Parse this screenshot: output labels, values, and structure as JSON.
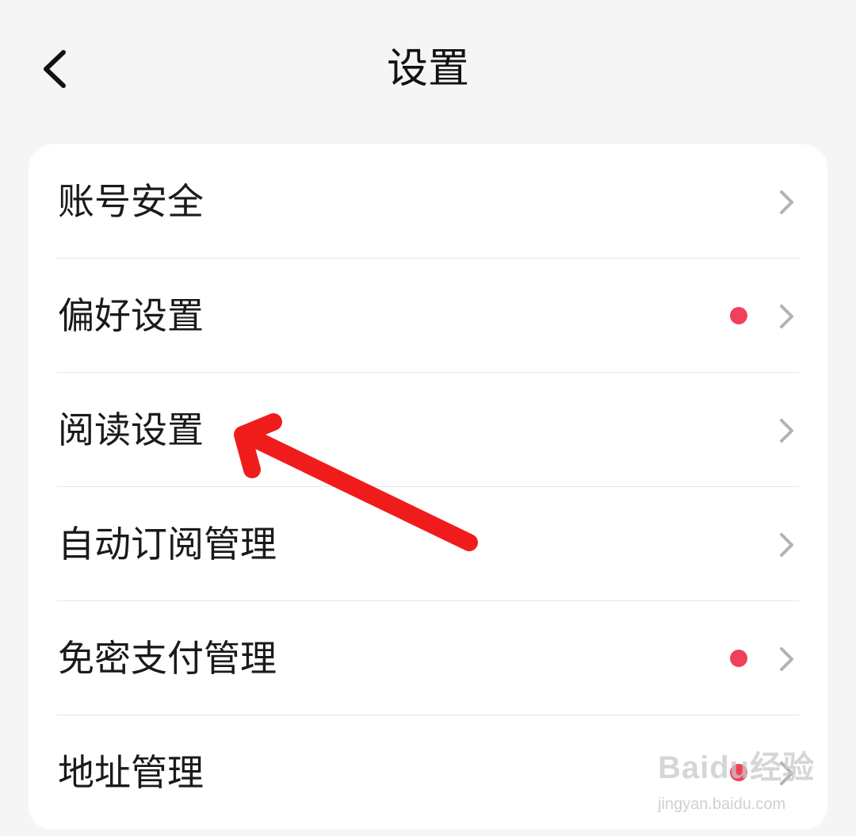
{
  "header": {
    "title": "设置",
    "back_icon": "chevron-left-icon"
  },
  "settings": {
    "items": [
      {
        "label": "账号安全",
        "has_badge": false
      },
      {
        "label": "偏好设置",
        "has_badge": true
      },
      {
        "label": "阅读设置",
        "has_badge": false
      },
      {
        "label": "自动订阅管理",
        "has_badge": false
      },
      {
        "label": "免密支付管理",
        "has_badge": true
      },
      {
        "label": "地址管理",
        "has_badge": true
      }
    ]
  },
  "colors": {
    "badge": "#f0405a",
    "annotation_arrow": "#f01c1c",
    "background": "#f5f5f5",
    "card": "#ffffff"
  },
  "watermark": {
    "brand": "Baidu经验",
    "url": "jingyan.baidu.com"
  }
}
